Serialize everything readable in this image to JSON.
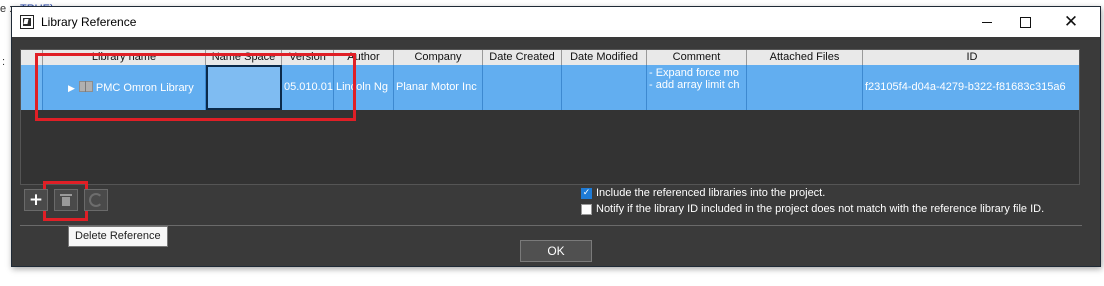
{
  "background": {
    "code_fragment_1": "e :",
    "code_fragment_1b": "TRUE)",
    "code_fragment_2": ":"
  },
  "window": {
    "title": "Library Reference",
    "icon": "app-window-icon"
  },
  "table": {
    "columns": [
      "Library name",
      "Name Space",
      "Version",
      "Author",
      "Company",
      "Date Created",
      "Date Modified",
      "Comment",
      "Attached Files",
      "ID"
    ],
    "rows": [
      {
        "library_name": "PMC Omron Library",
        "name_space": "",
        "version": "05.010.01",
        "author": "Lincoln Ng",
        "company": "Planar Motor Inc",
        "date_created": "",
        "date_modified": "",
        "comment_line1": "- Expand force mo",
        "comment_line2": "- add array limit ch",
        "attached_files": "",
        "id": "f23105f4-d04a-4279-b322-f81683c315a6"
      }
    ]
  },
  "toolbar": {
    "add_icon": "plus-icon",
    "delete_icon": "trash-icon",
    "refresh_icon": "refresh-icon"
  },
  "options": {
    "include_label": "Include the referenced libraries into the project.",
    "include_checked": true,
    "notify_label": "Notify if the library ID included in the project does not match with the reference library file ID.",
    "notify_checked": false
  },
  "tooltip": "Delete Reference",
  "ok_label": "OK",
  "colors": {
    "selection": "#62aef0",
    "highlight": "#e01f26",
    "dialog_bg": "#3a3a3a"
  }
}
